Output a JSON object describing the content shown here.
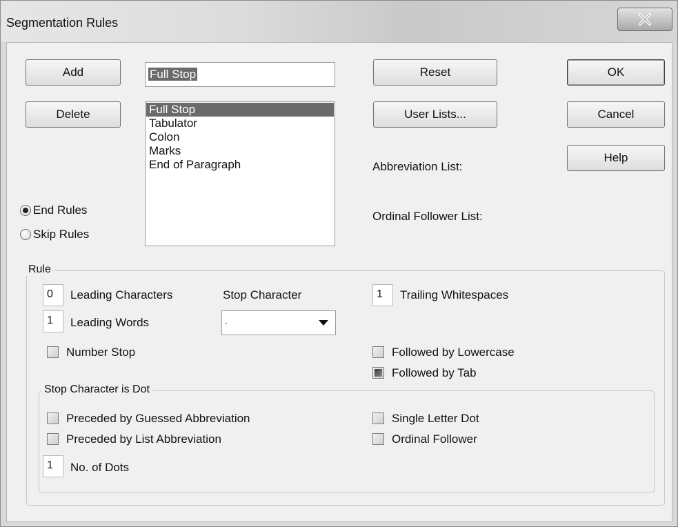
{
  "window": {
    "title": "Segmentation Rules",
    "close_glyph": "X"
  },
  "buttons": {
    "add": "Add",
    "delete": "Delete",
    "reset": "Reset",
    "user_lists": "User Lists...",
    "ok": "OK",
    "cancel": "Cancel",
    "help": "Help"
  },
  "rule_name": {
    "value": "Full Stop"
  },
  "rule_list": {
    "items": [
      "Full Stop",
      "Tabulator",
      "Colon",
      "Marks",
      "End of Paragraph"
    ],
    "selected_index": 0
  },
  "lists": {
    "abbreviation": "Abbreviation List:",
    "ordinal_follower": "Ordinal Follower List:"
  },
  "rule_type": {
    "end_rules": "End Rules",
    "skip_rules": "Skip Rules",
    "selected": "end_rules"
  },
  "rule": {
    "group_title": "Rule",
    "leading_characters": {
      "value": "0",
      "label": "Leading Characters"
    },
    "leading_words": {
      "value": "1",
      "label": "Leading Words"
    },
    "stop_character": {
      "label": "Stop Character",
      "value": "."
    },
    "trailing_whitespaces": {
      "value": "1",
      "label": "Trailing Whitespaces"
    },
    "number_stop": {
      "label": "Number Stop",
      "checked": false
    },
    "followed_by_lowercase": {
      "label": "Followed by Lowercase",
      "checked": false
    },
    "followed_by_tab": {
      "label": "Followed by Tab",
      "state": "indeterminate"
    }
  },
  "dot": {
    "group_title": "Stop Character is Dot",
    "guessed_abbreviation": {
      "label": "Preceded by Guessed Abbreviation",
      "checked": false
    },
    "list_abbreviation": {
      "label": "Preceded by List Abbreviation",
      "checked": false
    },
    "single_letter_dot": {
      "label": "Single Letter Dot",
      "checked": false
    },
    "ordinal_follower": {
      "label": "Ordinal Follower",
      "checked": false
    },
    "no_of_dots": {
      "value": "1",
      "label": "No. of Dots"
    }
  },
  "colors": {
    "selection": "#6a6a6a",
    "dialog_bg": "#f0f0f0"
  }
}
